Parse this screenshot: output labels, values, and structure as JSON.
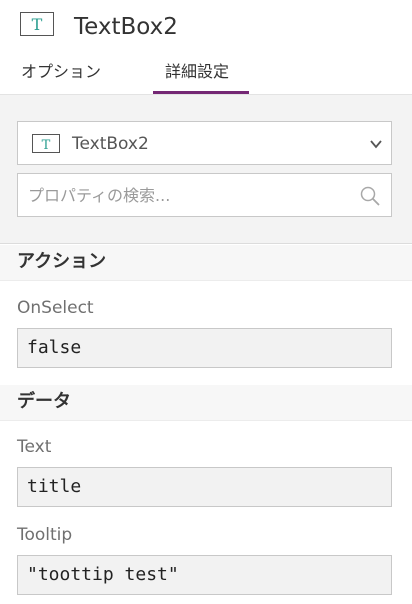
{
  "header": {
    "control_icon": "textbox-icon",
    "title": "TextBox2",
    "tabs": [
      {
        "label": "オプション",
        "active": false
      },
      {
        "label": "詳細設定",
        "active": true
      }
    ],
    "accent_color": "#742774"
  },
  "control_selector": {
    "icon": "textbox-icon",
    "value": "TextBox2",
    "dropdown_icon": "chevron-down-icon"
  },
  "search": {
    "placeholder": "プロパティの検索...",
    "icon": "search-icon"
  },
  "sections": [
    {
      "title": "アクション",
      "properties": [
        {
          "name": "OnSelect",
          "value": "false"
        }
      ]
    },
    {
      "title": "データ",
      "properties": [
        {
          "name": "Text",
          "value": "title"
        },
        {
          "name": "Tooltip",
          "value": "\"toottip test\""
        }
      ]
    }
  ]
}
